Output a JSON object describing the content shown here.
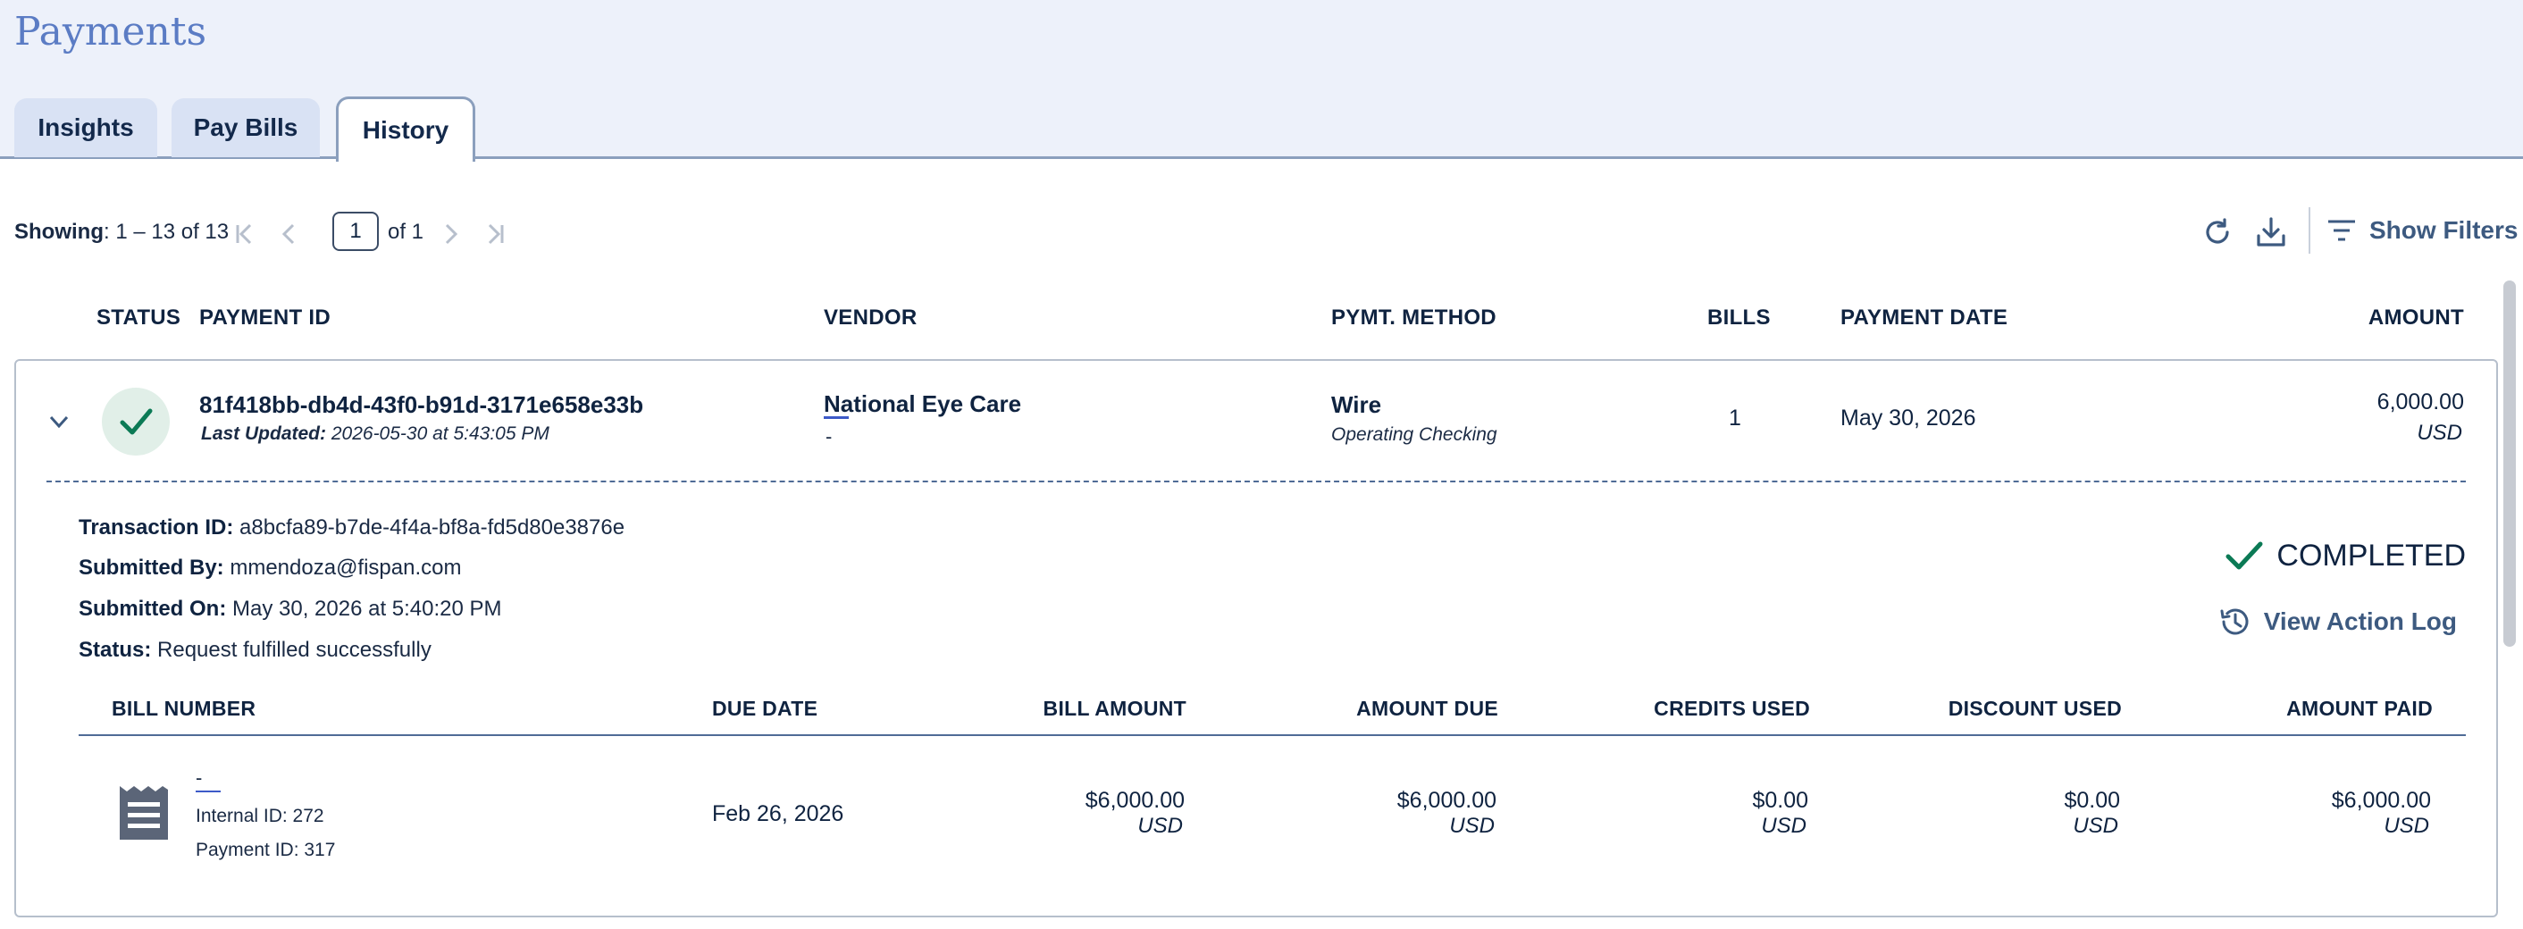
{
  "page": {
    "title": "Payments"
  },
  "tabs": [
    {
      "label": "Insights",
      "active": false
    },
    {
      "label": "Pay Bills",
      "active": false
    },
    {
      "label": "History",
      "active": true
    }
  ],
  "pagination": {
    "showing_label": "Showing",
    "showing_range": ": 1 – 13 of 13",
    "current_page": "1",
    "of_pages": "of 1"
  },
  "toolbar": {
    "refresh_icon": "refresh-icon",
    "download_icon": "download-icon",
    "filters_label": "Show Filters"
  },
  "columns": {
    "status": "STATUS",
    "payment_id": "PAYMENT ID",
    "vendor": "VENDOR",
    "method": "PYMT. METHOD",
    "bills": "BILLS",
    "payment_date": "PAYMENT DATE",
    "amount": "AMOUNT"
  },
  "payment": {
    "id": "81f418bb-db4d-43f0-b91d-3171e658e33b",
    "last_updated_label": "Last Updated:",
    "last_updated_value": " 2026-05-30 at 5:43:05 PM",
    "vendor": "National Eye Care",
    "vendor_sub": "-",
    "method": "Wire",
    "method_account": "Operating Checking",
    "bills": "1",
    "date": "May 30, 2026",
    "amount": "6,000.00",
    "currency": "USD",
    "status_color": "#0b7a55"
  },
  "details": {
    "transaction_label": "Transaction ID:",
    "transaction_value": " a8bcfa89-b7de-4f4a-bf8a-fd5d80e3876e",
    "submitted_by_label": "Submitted By:",
    "submitted_by_value": " mmendoza@fispan.com",
    "submitted_on_label": "Submitted On:",
    "submitted_on_value": " May 30, 2026 at 5:40:20 PM",
    "status_label": "Status:",
    "status_value": " Request fulfilled successfully",
    "completed_label": "COMPLETED",
    "action_log_label": "View Action Log"
  },
  "bill_columns": {
    "bill_number": "BILL NUMBER",
    "due_date": "DUE DATE",
    "bill_amount": "BILL AMOUNT",
    "amount_due": "AMOUNT DUE",
    "credits_used": "CREDITS USED",
    "discount_used": "DISCOUNT USED",
    "amount_paid": "AMOUNT PAID"
  },
  "bill": {
    "number": "-",
    "internal_id": "Internal ID: 272",
    "payment_id": "Payment ID: 317",
    "due_date": "Feb 26, 2026",
    "bill_amount": "$6,000.00",
    "amount_due": "$6,000.00",
    "credits_used": "$0.00",
    "discount_used": "$0.00",
    "amount_paid": "$6,000.00",
    "currency": "USD"
  }
}
